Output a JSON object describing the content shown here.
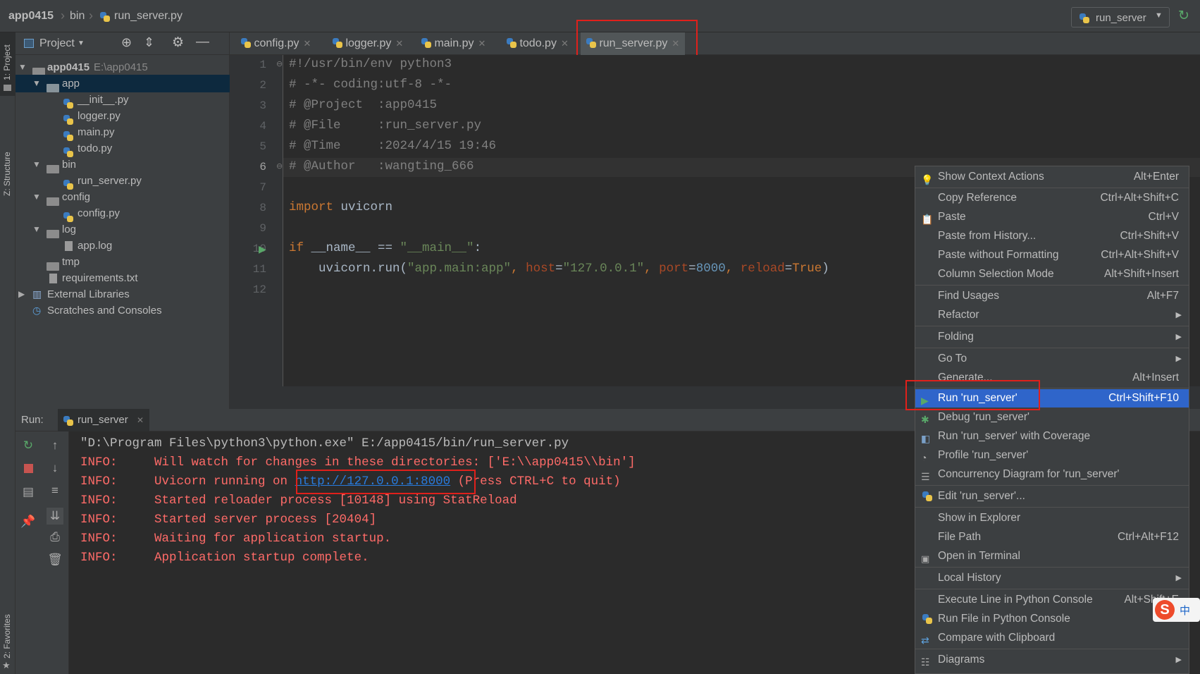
{
  "breadcrumb": {
    "project": "app0415",
    "folder": "bin",
    "file": "run_server.py"
  },
  "run_config": {
    "label": "run_server"
  },
  "left_strip": {
    "project_label": "1: Project",
    "structure_label": "Z: Structure",
    "favorites_label": "2: Favorites"
  },
  "project_panel": {
    "title": "Project",
    "tree": [
      {
        "label": "app0415",
        "extra": "E:\\app0415"
      },
      {
        "label": "app"
      },
      {
        "label": "__init__.py"
      },
      {
        "label": "logger.py"
      },
      {
        "label": "main.py"
      },
      {
        "label": "todo.py"
      },
      {
        "label": "bin"
      },
      {
        "label": "run_server.py"
      },
      {
        "label": "config"
      },
      {
        "label": "config.py"
      },
      {
        "label": "log"
      },
      {
        "label": "app.log"
      },
      {
        "label": "tmp"
      },
      {
        "label": "requirements.txt"
      },
      {
        "label": "External Libraries"
      },
      {
        "label": "Scratches and Consoles"
      }
    ]
  },
  "tabs": [
    "config.py",
    "logger.py",
    "main.py",
    "todo.py",
    "run_server.py"
  ],
  "editor": {
    "line_numbers": [
      "1",
      "2",
      "3",
      "4",
      "5",
      "6",
      "7",
      "8",
      "9",
      "10",
      "11",
      "12"
    ],
    "lines": {
      "l1": "#!/usr/bin/env python3",
      "l2": "# -*- coding:utf-8 -*-",
      "l3": "# @Project  :app0415",
      "l4": "# @File     :run_server.py",
      "l5": "# @Time     :2024/4/15 19:46",
      "l6": "# @Author   :wangting_666",
      "l8_kw": "import",
      "l8_rest": " uvicorn",
      "l10_kw": "if",
      "l10_a": " __name__ == ",
      "l10_str": "\"__main__\"",
      "l10_b": ":",
      "l11_a": "    uvicorn.run(",
      "l11_s1": "\"app.main:app\"",
      "l11_c1": ", ",
      "l11_k1": "host",
      "l11_e1": "=",
      "l11_s2": "\"127.0.0.1\"",
      "l11_c2": ", ",
      "l11_k2": "port",
      "l11_e2": "=",
      "l11_n": "8000",
      "l11_c3": ", ",
      "l11_k3": "reload",
      "l11_e3": "=",
      "l11_t": "True",
      "l11_end": ")"
    }
  },
  "run_panel": {
    "label": "Run:",
    "tab": "run_server",
    "console": {
      "cmd": "\"D:\\Program Files\\python3\\python.exe\" E:/app0415/bin/run_server.py",
      "lines": [
        "INFO:     Will watch for changes in these directories: ['E:\\\\app0415\\\\bin']",
        "INFO:     Uvicorn running on ",
        "INFO:     Started reloader process [10148] using StatReload",
        "INFO:     Started server process [20404]",
        "INFO:     Waiting for application startup.",
        "INFO:     Application startup complete."
      ],
      "url": "http://127.0.0.1:8000",
      "after_url": " (Press CTRL+C to quit)"
    }
  },
  "context_menu": [
    {
      "label": "Show Context Actions",
      "shortcut": "Alt+Enter"
    },
    {
      "label": "Copy Reference",
      "shortcut": "Ctrl+Alt+Shift+C"
    },
    {
      "label": "Paste",
      "shortcut": "Ctrl+V"
    },
    {
      "label": "Paste from History...",
      "shortcut": "Ctrl+Shift+V"
    },
    {
      "label": "Paste without Formatting",
      "shortcut": "Ctrl+Alt+Shift+V"
    },
    {
      "label": "Column Selection Mode",
      "shortcut": "Alt+Shift+Insert"
    },
    {
      "label": "Find Usages",
      "shortcut": "Alt+F7"
    },
    {
      "label": "Refactor",
      "shortcut": ""
    },
    {
      "label": "Folding",
      "shortcut": ""
    },
    {
      "label": "Go To",
      "shortcut": ""
    },
    {
      "label": "Generate...",
      "shortcut": "Alt+Insert"
    },
    {
      "label": "Run 'run_server'",
      "shortcut": "Ctrl+Shift+F10"
    },
    {
      "label": "Debug 'run_server'",
      "shortcut": ""
    },
    {
      "label": "Run 'run_server' with Coverage",
      "shortcut": ""
    },
    {
      "label": "Profile 'run_server'",
      "shortcut": ""
    },
    {
      "label": "Concurrency Diagram for 'run_server'",
      "shortcut": ""
    },
    {
      "label": "Edit 'run_server'...",
      "shortcut": ""
    },
    {
      "label": "Show in Explorer",
      "shortcut": ""
    },
    {
      "label": "File Path",
      "shortcut": "Ctrl+Alt+F12"
    },
    {
      "label": "Open in Terminal",
      "shortcut": ""
    },
    {
      "label": "Local History",
      "shortcut": ""
    },
    {
      "label": "Execute Line in Python Console",
      "shortcut": "Alt+Shift+E"
    },
    {
      "label": "Run File in Python Console",
      "shortcut": ""
    },
    {
      "label": "Compare with Clipboard",
      "shortcut": ""
    },
    {
      "label": "Diagrams",
      "shortcut": ""
    }
  ],
  "ime": {
    "label": "中"
  }
}
